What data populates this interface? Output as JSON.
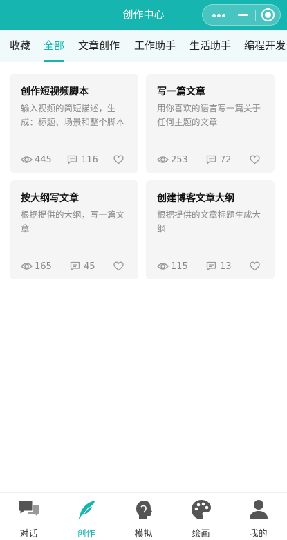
{
  "header": {
    "title": "创作中心"
  },
  "tabs": [
    {
      "label": "收藏"
    },
    {
      "label": "全部"
    },
    {
      "label": "文章创作"
    },
    {
      "label": "工作助手"
    },
    {
      "label": "生活助手"
    },
    {
      "label": "编程开发"
    }
  ],
  "active_tab": "全部",
  "cards": [
    {
      "title": "创作短视频脚本",
      "desc": "输入视频的简短描述，生成：标题、场景和整个脚本",
      "views": "445",
      "comments": "116"
    },
    {
      "title": "写一篇文章",
      "desc": "用你喜欢的语言写一篇关于任何主题的文章",
      "views": "253",
      "comments": "72"
    },
    {
      "title": "按大纲写文章",
      "desc": "根据提供的大纲，写一篇文章",
      "views": "165",
      "comments": "45"
    },
    {
      "title": "创建博客文章大纲",
      "desc": "根据提供的文章标题生成大纲",
      "views": "115",
      "comments": "13"
    }
  ],
  "nav": [
    {
      "label": "对话",
      "icon": "chat-icon"
    },
    {
      "label": "创作",
      "icon": "feather-icon"
    },
    {
      "label": "模拟",
      "icon": "head-profile-icon"
    },
    {
      "label": "绘画",
      "icon": "palette-icon"
    },
    {
      "label": "我的",
      "icon": "user-icon"
    }
  ],
  "colors": {
    "accent": "#17b5b0",
    "card_bg": "#f5f5f5",
    "muted_text": "#8a8a8a"
  }
}
